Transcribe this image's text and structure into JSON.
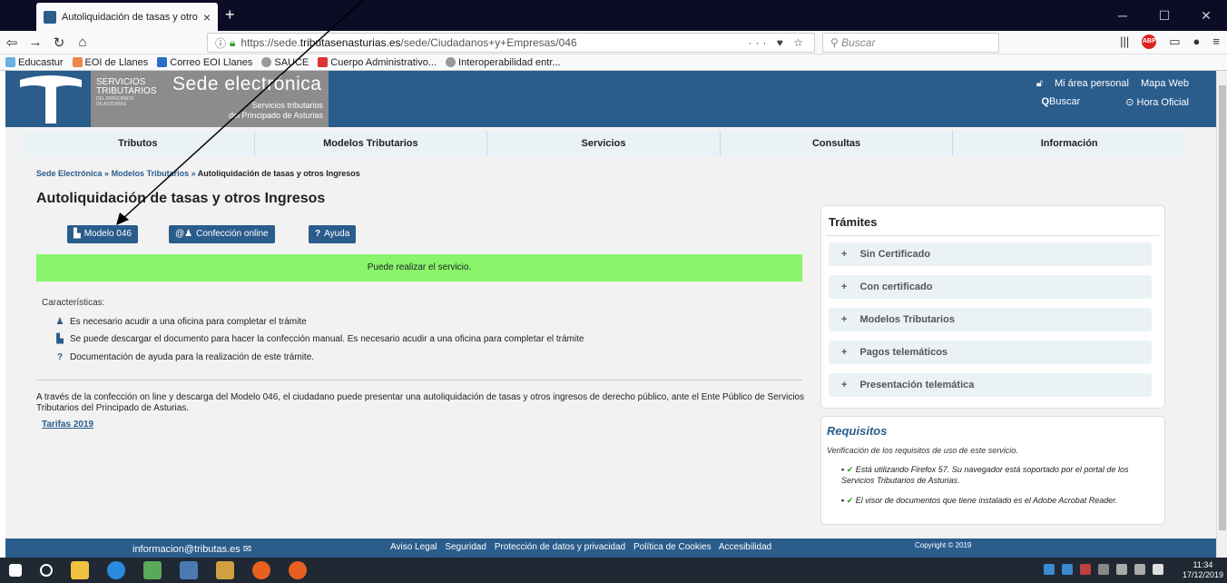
{
  "browser": {
    "tab_title": "Autoliquidación de tasas y otro",
    "tab_close": "×",
    "new_tab": "+",
    "url_prefix": "https://sede.",
    "url_host": "tributasenasturias.es",
    "url_path": "/sede/Ciudadanos+y+Empresas/046",
    "url_tools": "··· ♥ ☆",
    "search_placeholder": "Buscar",
    "bookmarks": [
      "Educastur",
      "EOI de Llanes",
      "Correo EOI Llanes",
      "SAUCE",
      "Cuerpo Administrativo...",
      "Interoperabilidad entr..."
    ]
  },
  "header": {
    "org_line1": "SERVICIOS",
    "org_line2": "TRIBUTARIOS",
    "org_line3": "DEL PRINCIPADO",
    "org_line4": "DE ASTURIAS",
    "title": "Sede electrónica",
    "subtitle1": "Servicios tributarios",
    "subtitle2": "del Principado de Asturias",
    "area_personal": "Mi área personal",
    "mapa_web": "Mapa Web",
    "buscar": "Buscar",
    "hora_oficial": "Hora Oficial"
  },
  "nav": [
    "Tributos",
    "Modelos Tributarios",
    "Servicios",
    "Consultas",
    "Información"
  ],
  "breadcrumb": {
    "sede": "Sede Electrónica",
    "sep": " » ",
    "modelos": "Modelos Tributarios",
    "current": "Autoliquidación de tasas y otros Ingresos"
  },
  "page_title": "Autoliquidación de tasas y otros Ingresos",
  "buttons": {
    "modelo": "Modelo 046",
    "confeccion": "Confección online",
    "ayuda": "Ayuda"
  },
  "status": "Puede realizar el servicio.",
  "caracteristicas": {
    "label": "Características:",
    "items": [
      "Es necesario acudir a una oficina para completar el trámite",
      "Se puede descargar el documento para hacer la confección manual. Es necesario acudir a una oficina para completar el trámite",
      "Documentación de ayuda para la realización de este trámite."
    ]
  },
  "description": "A través de la confección on line y descarga del Modelo 046, el ciudadano puede presentar una autoliquidación de tasas y otros ingresos de derecho público, ante el Ente Público de Servicios Tributarios del Principado de Asturias.",
  "tarifas_link": "Tarifas 2019",
  "tramites": {
    "title": "Trámites",
    "items": [
      "Sin Certificado",
      "Con certificado",
      "Modelos Tributarios",
      "Pagos telemáticos",
      "Presentación telemática"
    ]
  },
  "requisitos": {
    "title": "Requisitos",
    "intro": "Verificación de los requisitos de uso de este servicio.",
    "item1": "Está utilizando Firefox 57. Su navegador está soportado por el portal de los Servicios Tributarios de Asturias.",
    "item2": "El visor de documentos que tiene instalado es el Adobe Acrobat Reader."
  },
  "footer": {
    "email": "informacion@tributas.es",
    "links": [
      "Aviso Legal",
      "Seguridad",
      "Protección de datos y privacidad",
      "Política de Cookies",
      "Accesibilidad"
    ],
    "copyright": "Copyright © 2019"
  },
  "taskbar": {
    "time": "11:34",
    "date": "17/12/2019"
  },
  "colors": {
    "brand": "#2a5c8c",
    "success_bar": "#88f56b",
    "check": "#2aa32a"
  }
}
